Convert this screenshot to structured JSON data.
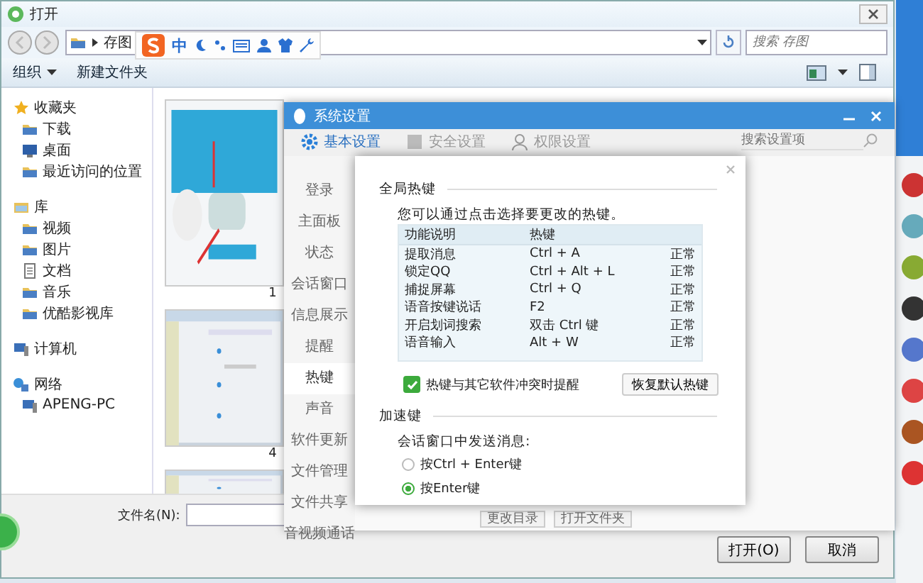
{
  "open_dialog": {
    "title": "打开",
    "path": "存图",
    "search_placeholder": "搜索 存图",
    "toolbar": [
      {
        "label": "组织",
        "kind": "menu"
      },
      {
        "label": "新建文件夹",
        "kind": "button"
      }
    ],
    "nav": [
      {
        "label": "收藏夹",
        "kind": "star",
        "children": [
          {
            "label": "下载",
            "kind": "folder"
          },
          {
            "label": "桌面",
            "kind": "desktop"
          },
          {
            "label": "最近访问的位置",
            "kind": "folder"
          }
        ]
      },
      {
        "label": "库",
        "kind": "library",
        "children": [
          {
            "label": "视频",
            "kind": "folder"
          },
          {
            "label": "图片",
            "kind": "folder"
          },
          {
            "label": "文档",
            "kind": "doc"
          },
          {
            "label": "音乐",
            "kind": "folder"
          },
          {
            "label": "优酷影视库",
            "kind": "folder"
          }
        ]
      },
      {
        "label": "计算机",
        "kind": "computer"
      },
      {
        "label": "网络",
        "kind": "network",
        "children": [
          {
            "label": "APENG-PC",
            "kind": "computer"
          }
        ]
      }
    ],
    "thumbnails": [
      {
        "label": "1"
      },
      {
        "label": "4"
      }
    ],
    "filename_label": "文件名(N):",
    "buttons": [
      "打开(O)",
      "取消"
    ]
  },
  "qq_settings": {
    "title": "系统设置",
    "search_placeholder": "搜索设置项",
    "tabs": [
      {
        "label": "基本设置",
        "selected": true
      },
      {
        "label": "安全设置",
        "selected": false
      },
      {
        "label": "权限设置",
        "selected": false
      }
    ],
    "menu": [
      {
        "label": "登录",
        "selected": false
      },
      {
        "label": "主面板",
        "selected": false
      },
      {
        "label": "状态",
        "selected": false
      },
      {
        "label": "会话窗口",
        "selected": false
      },
      {
        "label": "信息展示",
        "selected": false
      },
      {
        "label": "提醒",
        "selected": false
      },
      {
        "label": "热键",
        "selected": true
      },
      {
        "label": "声音",
        "selected": false
      },
      {
        "label": "软件更新",
        "selected": false
      },
      {
        "label": "文件管理",
        "selected": false
      },
      {
        "label": "文件共享",
        "selected": false
      },
      {
        "label": "音视频通话",
        "selected": false
      }
    ],
    "bottom_buttons": [
      "更改目录",
      "打开文件夹"
    ]
  },
  "hotkey_dialog": {
    "section_title": "全局热键",
    "hint": "您可以通过点击选择要更改的热键。",
    "columns": [
      "功能说明",
      "热键"
    ],
    "rows": [
      {
        "function": "提取消息",
        "hotkey": "Ctrl + A",
        "status": "正常"
      },
      {
        "function": "锁定QQ",
        "hotkey": "Ctrl + Alt + L",
        "status": "正常"
      },
      {
        "function": "捕捉屏幕",
        "hotkey": "Ctrl + Q",
        "status": "正常"
      },
      {
        "function": "语音按键说话",
        "hotkey": "F2",
        "status": "正常"
      },
      {
        "function": "开启划词搜索",
        "hotkey": "双击 Ctrl 键",
        "status": "正常"
      },
      {
        "function": "语音输入",
        "hotkey": "Alt + W",
        "status": "正常"
      }
    ],
    "conflict_reminder": {
      "label": "热键与其它软件冲突时提醒",
      "checked": true
    },
    "reset_button": "恢复默认热键",
    "accel_title": "加速键",
    "accel_hint": "会话窗口中发送消息:",
    "send_options": [
      {
        "label": "按Ctrl + Enter键",
        "selected": false
      },
      {
        "label": "按Enter键",
        "selected": true
      }
    ]
  },
  "ime_toolbar": {
    "mode": "中"
  }
}
